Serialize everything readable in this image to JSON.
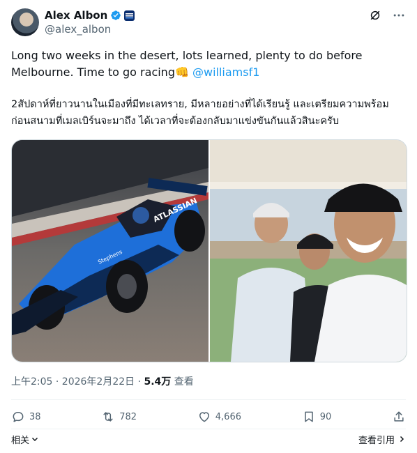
{
  "author": {
    "display_name": "Alex Albon",
    "handle": "@alex_albon"
  },
  "tweet": {
    "line1": "Long two weeks in the desert, lots learned, plenty to do before Melbourne. Time to go racing",
    "emoji": "👊",
    "mention": "@williamsf1",
    "thai": "2สัปดาห์ที่ยาวนานในเมืองที่มีทะเลทราย, มีหลายอย่างที่ได้เรียนรู้ และเตรียมความพร้อมก่อนสนามที่เมลเบิร์นจะมาถึง ได้เวลาที่จะต้องกลับมาแข่งขันกันแล้วสินะครับ"
  },
  "meta": {
    "time": "上午2:05 · 2026年2月22日 · ",
    "views_count": "5.4万",
    "views_label": " 查看"
  },
  "actions": {
    "replies": "38",
    "reposts": "782",
    "likes": "4,666",
    "bookmarks": "90"
  },
  "footer": {
    "related": "相关",
    "view_quotes": "查看引用"
  },
  "colors": {
    "accent": "#1d9bf0",
    "secondary_text": "#536471",
    "williams_blue": "#1e6fd9"
  },
  "icons": [
    "verified-icon",
    "affiliate-badge-icon",
    "grok-icon",
    "more-icon",
    "reply-icon",
    "repost-icon",
    "like-icon",
    "bookmark-icon",
    "share-icon",
    "chevron-down-icon",
    "chevron-right-icon"
  ]
}
